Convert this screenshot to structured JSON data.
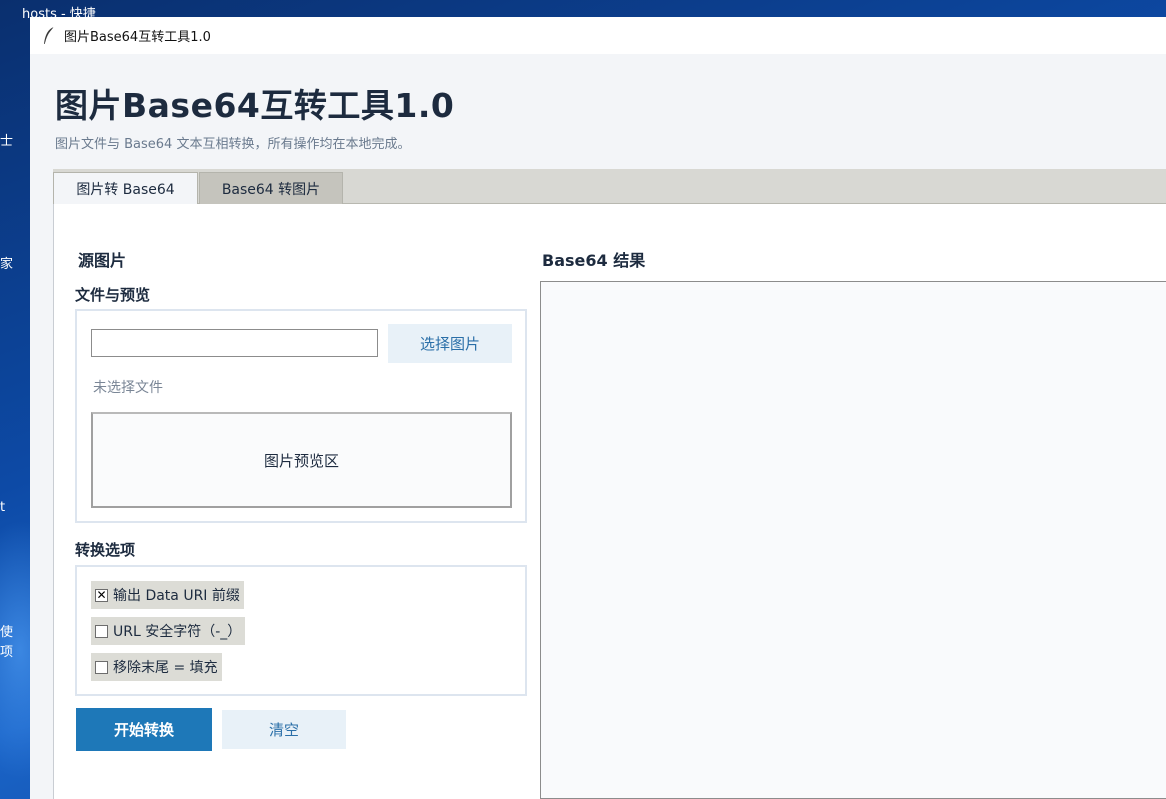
{
  "desktop": {
    "labels": [
      "hosts - 快捷",
      "士",
      "家",
      "t",
      "使",
      "项"
    ]
  },
  "window": {
    "title": "图片Base64互转工具1.0"
  },
  "app": {
    "title": "图片Base64互转工具1.0",
    "subtitle": "图片文件与 Base64 文本互相转换，所有操作均在本地完成。"
  },
  "tabs": [
    {
      "label": "图片转 Base64",
      "active": true
    },
    {
      "label": "Base64 转图片",
      "active": false
    }
  ],
  "source": {
    "heading": "源图片",
    "file_group_title": "文件与预览",
    "file_path_value": "",
    "choose_button": "选择图片",
    "file_status": "未选择文件",
    "preview_placeholder": "图片预览区"
  },
  "options": {
    "title": "转换选项",
    "items": [
      {
        "label": "输出 Data URI 前缀",
        "checked": true,
        "mark": "✕"
      },
      {
        "label": "URL 安全字符（-_）",
        "checked": false,
        "mark": ""
      },
      {
        "label": "移除末尾 = 填充",
        "checked": false,
        "mark": ""
      }
    ]
  },
  "actions": {
    "convert": "开始转换",
    "clear": "清空"
  },
  "result": {
    "heading": "Base64 结果",
    "value": ""
  },
  "colors": {
    "accent": "#1e78b8",
    "button_light": "#e8f1f8",
    "tab_bar": "#d8d8d3"
  }
}
